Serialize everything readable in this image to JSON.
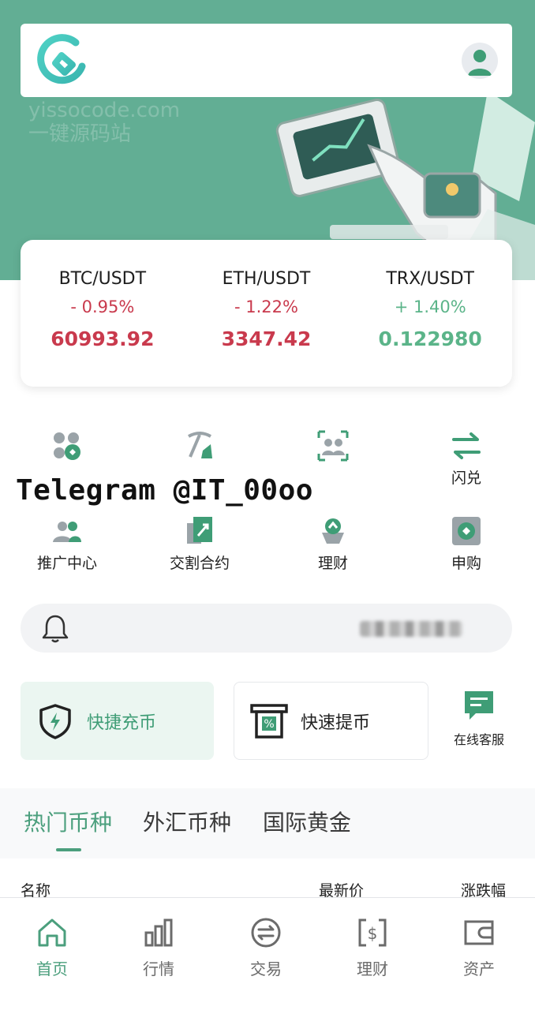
{
  "hero": {
    "watermark_line1": "yissocode.com",
    "watermark_line2": "一键源码站"
  },
  "ticker": [
    {
      "pair": "BTC/USDT",
      "change": "- 0.95%",
      "price": "60993.92",
      "trend": "down"
    },
    {
      "pair": "ETH/USDT",
      "change": "- 1.22%",
      "price": "3347.42",
      "trend": "down"
    },
    {
      "pair": "TRX/USDT",
      "change": "+ 1.40%",
      "price": "0.122980",
      "trend": "up"
    }
  ],
  "features": [
    {
      "label": "",
      "icon": "coins-icon"
    },
    {
      "label": "",
      "icon": "pickaxe-icon"
    },
    {
      "label": "",
      "icon": "users-scan-icon"
    },
    {
      "label": "闪兑",
      "icon": "swap-arrows-icon"
    },
    {
      "label": "推广中心",
      "icon": "referral-users-icon"
    },
    {
      "label": "交割合约",
      "icon": "contract-chart-icon"
    },
    {
      "label": "理财",
      "icon": "wealth-pot-icon"
    },
    {
      "label": "申购",
      "icon": "subscribe-icon"
    }
  ],
  "overlay_banner": "Telegram @IT_00oo",
  "notice": {
    "text": "一条新的公告"
  },
  "quick": {
    "deposit": "快捷充币",
    "withdraw": "快速提币",
    "service": "在线客服"
  },
  "tabs": [
    "热门币种",
    "外汇币种",
    "国际黄金"
  ],
  "columns": {
    "name": "名称",
    "price": "最新价",
    "change": "涨跌幅"
  },
  "nav": [
    "首页",
    "行情",
    "交易",
    "理财",
    "资产"
  ],
  "colors": {
    "brand": "#62ae94",
    "accent": "#4b9f7d",
    "down": "#c93a4d",
    "up": "#5bb489"
  }
}
